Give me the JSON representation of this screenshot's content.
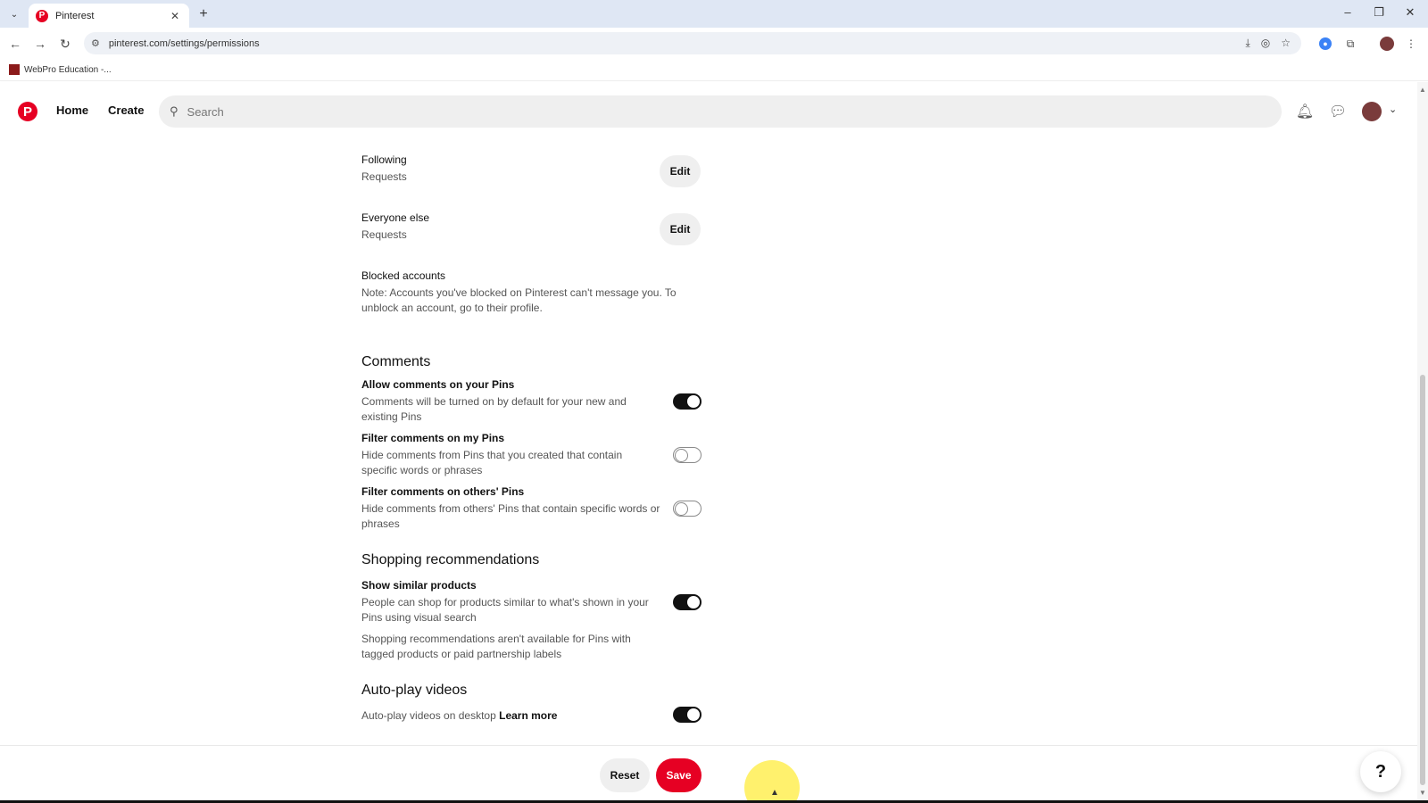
{
  "browser": {
    "tab_title": "Pinterest",
    "tab_favicon": "P",
    "url": "pinterest.com/settings/permissions",
    "bookmark_label": "WebPro Education -..."
  },
  "header": {
    "logo": "P",
    "nav_home": "Home",
    "nav_create": "Create",
    "search_placeholder": "Search"
  },
  "messages": {
    "following": {
      "title": "Following",
      "value": "Requests",
      "button": "Edit"
    },
    "everyone_else": {
      "title": "Everyone else",
      "value": "Requests",
      "button": "Edit"
    },
    "blocked": {
      "title": "Blocked accounts",
      "note": "Note: Accounts you've blocked on Pinterest can't message you. To unblock an account, go to their profile."
    }
  },
  "comments": {
    "heading": "Comments",
    "allow": {
      "title": "Allow comments on your Pins",
      "desc": "Comments will be turned on by default for your new and existing Pins",
      "on": true
    },
    "filter_mine": {
      "title": "Filter comments on my Pins",
      "desc": "Hide comments from Pins that you created that contain specific words or phrases",
      "on": false
    },
    "filter_others": {
      "title": "Filter comments on others' Pins",
      "desc": "Hide comments from others' Pins that contain specific words or phrases",
      "on": false
    }
  },
  "shopping": {
    "heading": "Shopping recommendations",
    "similar": {
      "title": "Show similar products",
      "desc": "People can shop for products similar to what's shown in your Pins using visual search",
      "on": true
    },
    "note": "Shopping recommendations aren't available for Pins with tagged products or paid partnership labels"
  },
  "autoplay": {
    "heading": "Auto-play videos",
    "desc": "Auto-play videos on desktop",
    "link": "Learn more",
    "on": true
  },
  "footer": {
    "reset": "Reset",
    "save": "Save",
    "help": "?"
  },
  "colors": {
    "brand": "#e60023",
    "toggle_on": "#111111"
  }
}
